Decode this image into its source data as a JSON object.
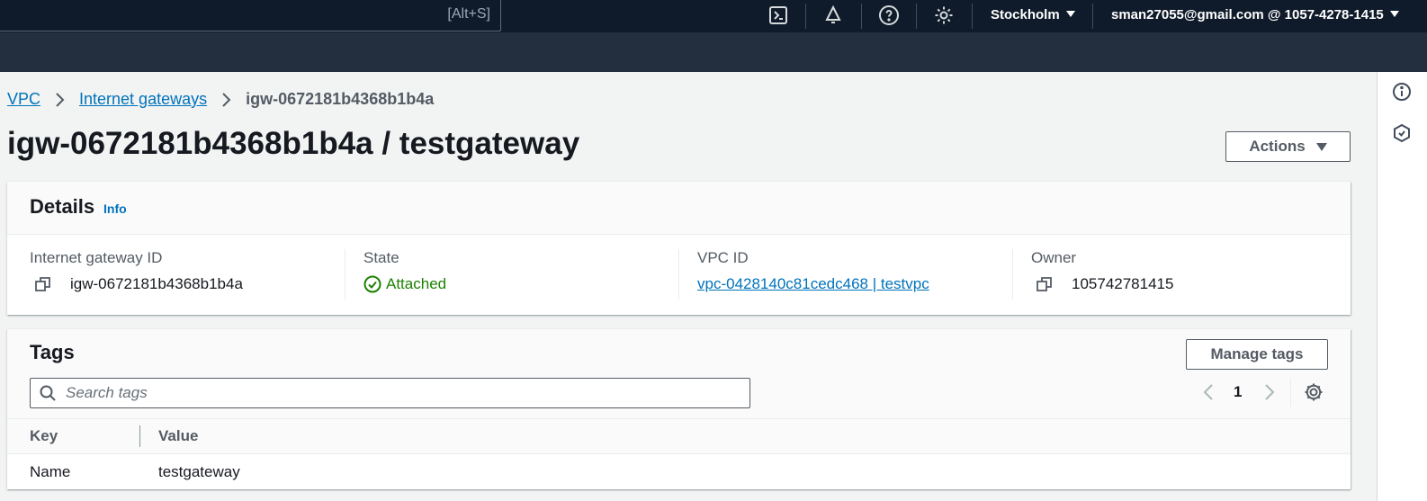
{
  "topnav": {
    "search_shortcut": "[Alt+S]",
    "region": "Stockholm",
    "account": "sman27055@gmail.com @ 1057-4278-1415"
  },
  "breadcrumb": {
    "items": [
      "VPC",
      "Internet gateways"
    ],
    "current": "igw-0672181b4368b1b4a"
  },
  "page": {
    "title": "igw-0672181b4368b1b4a / testgateway",
    "actions_label": "Actions"
  },
  "details": {
    "title": "Details",
    "info": "Info",
    "fields": {
      "gateway_id_label": "Internet gateway ID",
      "gateway_id_value": "igw-0672181b4368b1b4a",
      "state_label": "State",
      "state_value": "Attached",
      "vpc_label": "VPC ID",
      "vpc_value": "vpc-0428140c81cedc468 | testvpc",
      "owner_label": "Owner",
      "owner_value": "105742781415"
    }
  },
  "tags": {
    "title": "Tags",
    "manage_label": "Manage tags",
    "search_placeholder": "Search tags",
    "page": "1",
    "columns": [
      "Key",
      "Value"
    ],
    "rows": [
      {
        "key": "Name",
        "value": "testgateway"
      }
    ]
  },
  "colors": {
    "nav_dark": "#0f1b2a",
    "nav": "#232f3e",
    "link": "#0073bb",
    "success": "#1d8102"
  }
}
